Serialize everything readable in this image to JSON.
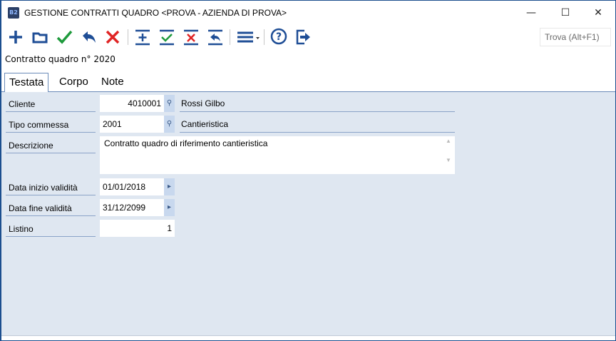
{
  "window": {
    "title": "GESTIONE CONTRATTI QUADRO <PROVA - AZIENDA DI PROVA>",
    "app_icon": "B2",
    "minimize": "—",
    "maximize": "☐",
    "close": "✕"
  },
  "toolbar": {
    "find_label": "Trova (Alt+F1)",
    "icons": [
      "plus-icon",
      "open-folder-icon",
      "check-icon",
      "undo-icon",
      "delete-icon",
      "add-row-icon",
      "confirm-row-icon",
      "delete-row-icon",
      "undo-row-icon",
      "menu-icon",
      "help-icon",
      "exit-icon"
    ],
    "colors": {
      "blue": "#1f4e96",
      "green": "#1e9a3c",
      "red": "#e02424"
    }
  },
  "header": "Contratto quadro n° 2020",
  "tabs": [
    {
      "label": "Testata",
      "active": true
    },
    {
      "label": "Corpo"
    },
    {
      "label": "Note"
    }
  ],
  "form": {
    "cliente": {
      "label": "Cliente",
      "value": "4010001",
      "desc": "Rossi Gilbo"
    },
    "tipo": {
      "label": "Tipo commessa",
      "value": "2001",
      "desc": "Cantieristica"
    },
    "descrizione": {
      "label": "Descrizione",
      "value": "Contratto quadro di riferimento cantieristica"
    },
    "inizio": {
      "label": "Data inizio validità",
      "value": "01/01/2018"
    },
    "fine": {
      "label": "Data fine validità",
      "value": "31/12/2099"
    },
    "listino": {
      "label": "Listino",
      "value": "1"
    }
  }
}
